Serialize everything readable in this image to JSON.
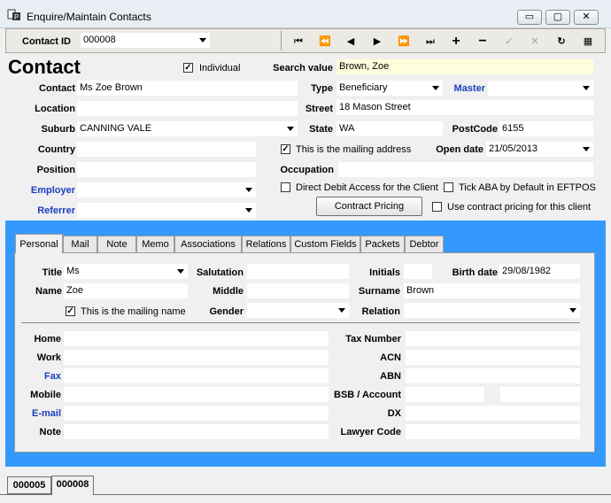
{
  "window": {
    "title": "Enquire/Maintain Contacts",
    "btn_min": "▭",
    "btn_max": "▢",
    "btn_close": "✕"
  },
  "toolbar": {
    "contact_id_label": "Contact ID",
    "contact_id_value": "000008",
    "nav": [
      "⏮",
      "⏪",
      "◀",
      "▶",
      "⏩",
      "⏭",
      "+",
      "−",
      "✓",
      "✕",
      "↻",
      "▦"
    ]
  },
  "header": {
    "title": "Contact",
    "individual_label": "Individual",
    "individual_checked": "✓",
    "search_label": "Search value",
    "search_value": "Brown, Zoe"
  },
  "form": {
    "contact_label": "Contact",
    "contact_value": "Ms Zoe Brown",
    "type_label": "Type",
    "type_value": "Beneficiary",
    "master_label": "Master",
    "master_value": "",
    "location_label": "Location",
    "location_value": "",
    "street_label": "Street",
    "street_value": "18 Mason Street",
    "suburb_label": "Suburb",
    "suburb_value": "CANNING VALE",
    "state_label": "State",
    "state_value": "WA",
    "postcode_label": "PostCode",
    "postcode_value": "6155",
    "country_label": "Country",
    "country_value": "",
    "mailing_label": "This is the mailing address",
    "mailing_checked": "✓",
    "opendate_label": "Open date",
    "opendate_value": "21/05/2013",
    "position_label": "Position",
    "position_value": "",
    "occupation_label": "Occupation",
    "occupation_value": "",
    "employer_label": "Employer",
    "employer_value": "",
    "directdebit_label": "Direct Debit Access for the Client",
    "tickaba_label": "Tick ABA by Default in EFTPOS",
    "referrer_label": "Referrer",
    "referrer_value": "",
    "contract_pricing_button": "Contract Pricing",
    "use_contract_label": "Use contract pricing for this client"
  },
  "tabs": [
    "Personal",
    "Mail",
    "Note",
    "Memo",
    "Associations",
    "Relations",
    "Custom Fields",
    "Packets",
    "Debtor"
  ],
  "personal": {
    "title_label": "Title",
    "title_value": "Ms",
    "salutation_label": "Salutation",
    "salutation_value": "",
    "initials_label": "Initials",
    "initials_value": "",
    "birthdate_label": "Birth date",
    "birthdate_value": "29/08/1982",
    "name_label": "Name",
    "name_value": "Zoe",
    "middle_label": "Middle",
    "middle_value": "",
    "surname_label": "Surname",
    "surname_value": "Brown",
    "mailingname_label": "This is the mailing name",
    "mailingname_checked": "✓",
    "gender_label": "Gender",
    "gender_value": "",
    "relation_label": "Relation",
    "relation_value": "",
    "home_label": "Home",
    "work_label": "Work",
    "fax_label": "Fax",
    "mobile_label": "Mobile",
    "email_label": "E-mail",
    "note_label": "Note",
    "tax_label": "Tax Number",
    "acn_label": "ACN",
    "abn_label": "ABN",
    "bsb_label": "BSB / Account",
    "dx_label": "DX",
    "lawyer_label": "Lawyer Code"
  },
  "bottom_tabs": [
    "000005",
    "000008"
  ]
}
